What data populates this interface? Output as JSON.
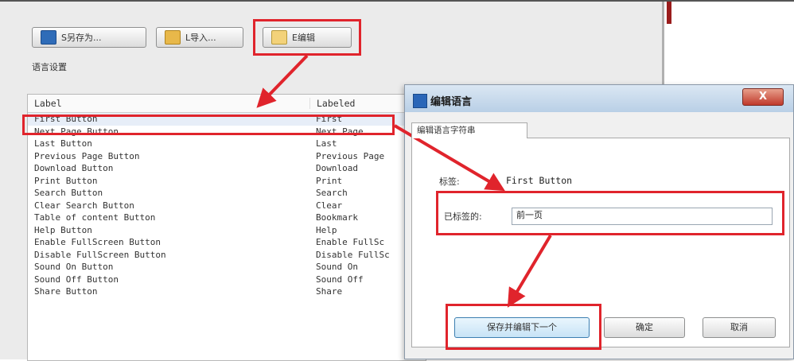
{
  "toolbar": {
    "save_as_label": "S另存为...",
    "import_label": "L导入...",
    "edit_label": "E编辑"
  },
  "section_label": "语言设置",
  "table": {
    "headers": [
      "Label",
      "Labeled"
    ],
    "rows": [
      [
        "First Button",
        "First"
      ],
      [
        "Next Page Button",
        "Next Page"
      ],
      [
        "Last Button",
        "Last"
      ],
      [
        "Previous Page Button",
        "Previous Page"
      ],
      [
        "Download Button",
        "Download"
      ],
      [
        "Print Button",
        "Print"
      ],
      [
        "Search Button",
        "Search"
      ],
      [
        "Clear Search Button",
        "Clear"
      ],
      [
        "Table of content Button",
        "Bookmark"
      ],
      [
        "Help Button",
        "Help"
      ],
      [
        "Enable FullScreen Button",
        "Enable FullSc"
      ],
      [
        "Disable FullScreen Button",
        "Disable FullSc"
      ],
      [
        "Sound On Button",
        "Sound On"
      ],
      [
        "Sound Off Button",
        "Sound Off"
      ],
      [
        "Share Button",
        "Share"
      ]
    ]
  },
  "dialog": {
    "title": "编辑语言",
    "close_label": "X",
    "tab_label": "编辑语言字符串",
    "label_caption": "标签:",
    "label_value": "First Button",
    "labeled_caption": "已标签的:",
    "labeled_value": "前一页",
    "save_next_label": "保存并编辑下一个",
    "ok_label": "确定",
    "cancel_label": "取消"
  },
  "colors": {
    "highlight_red": "#e0242c"
  }
}
